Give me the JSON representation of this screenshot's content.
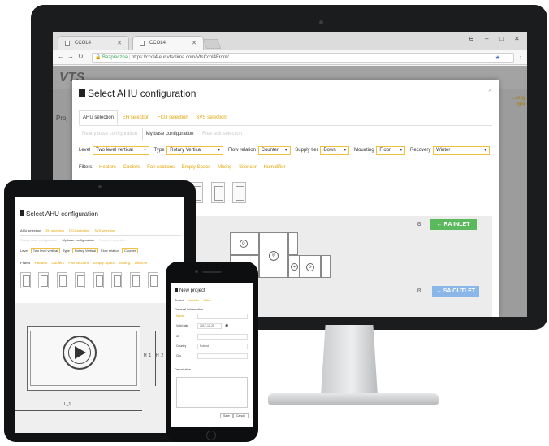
{
  "desktop": {
    "tabs": [
      {
        "label": "CCOL4"
      },
      {
        "label": "CCOL4"
      }
    ],
    "window_controls": {
      "user": "⊖",
      "minimize": "–",
      "maximize": "□",
      "close": "✕"
    },
    "address": {
      "secure_label": "Bezpieczna",
      "url": "https://ccol4.eur.vtsclima.com/VtsCcol4Front/"
    },
    "app": {
      "logo": "VTS",
      "left_tab": "Proj",
      "right_text_1": "...ergy",
      "right_text_2": "HP4"
    },
    "modal": {
      "title": "Select AHU configuration",
      "close": "×",
      "tabs": [
        {
          "label": "AHU selection",
          "active": true
        },
        {
          "label": "EH selection",
          "active": false
        },
        {
          "label": "FCU selection",
          "active": false
        },
        {
          "label": "SVS selection",
          "active": false
        }
      ],
      "sub_tabs": [
        {
          "label": "Ready base configuration",
          "active": false
        },
        {
          "label": "My base configuration",
          "active": true
        },
        {
          "label": "Free edit selection",
          "active": false
        }
      ],
      "filters": {
        "level_label": "Level",
        "level_value": "Two level vertical",
        "type_label": "Type",
        "type_value": "Rotary Vertical",
        "flow_label": "Flow relation",
        "flow_value": "Counter",
        "supply_label": "Supply tier",
        "supply_value": "Down",
        "mounting_label": "Mounting",
        "mounting_value": "Floor",
        "recovery_label": "Recovery",
        "recovery_value": "Winter"
      },
      "components": [
        "Filters",
        "Heaters",
        "Coolers",
        "Fan sections",
        "Empty Space",
        "Mixing",
        "Silencer",
        "Humidifier"
      ],
      "ra_inlet": "← RA INLET",
      "sa_outlet": "→ SA OUTLET"
    }
  },
  "tablet": {
    "title": "Select AHU configuration",
    "tabs": [
      "AHU selection",
      "EH selection",
      "FCU selection",
      "SVS selection"
    ],
    "sub_tabs": [
      "Ready base configuration",
      "My base configuration",
      "Free edit selection"
    ],
    "level_label": "Level",
    "level_value": "Two level vertical",
    "type_label": "Type",
    "type_value": "Rotary Vertical",
    "flow_label": "Flow relation",
    "flow_value": "Counter",
    "components": [
      "Filters",
      "Heaters",
      "Coolers",
      "Fan sections",
      "Empty Space",
      "Mixing",
      "Silencer"
    ],
    "dim_h1": "H_1",
    "dim_h2": "H_2",
    "dim_l1": "L_1"
  },
  "phone": {
    "title": "New project",
    "tabs": [
      "Project",
      "Variables",
      "Offers"
    ],
    "section_general": "General information",
    "fields": [
      {
        "label": "Name",
        "value": ""
      },
      {
        "label": "Valid date",
        "value": "2017-10-25"
      },
      {
        "label": "ID",
        "value": ""
      },
      {
        "label": "Country",
        "value": "Poland"
      },
      {
        "label": "City",
        "value": ""
      }
    ],
    "section_description": "Description",
    "buttons": [
      "Save",
      "Cancel"
    ]
  }
}
